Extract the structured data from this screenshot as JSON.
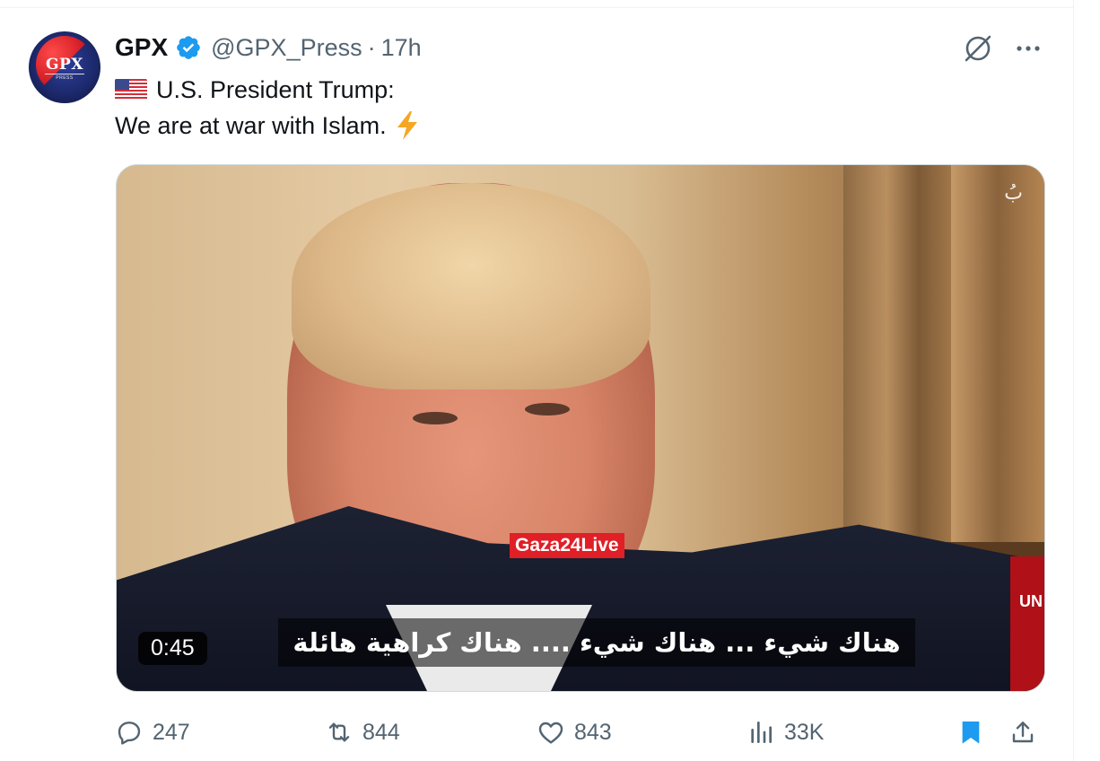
{
  "tweet": {
    "display_name": "GPX",
    "handle": "@GPX_Press",
    "separator": "·",
    "time": "17h",
    "avatar_text": "GPX",
    "avatar_subtext": "PRESS",
    "line1": "U.S. President Trump:",
    "line2": "We are at war with Islam."
  },
  "media": {
    "duration": "0:45",
    "channel_tag": "Gaza24Live",
    "subtitle": "هناك شيء ... هناك شيء .... هناك كراهية هائلة",
    "ticker_text": "UN",
    "watermark": "بُ"
  },
  "actions": {
    "replies": "247",
    "reposts": "844",
    "likes": "843",
    "views": "33K"
  },
  "colors": {
    "verified": "#1d9bf0",
    "bookmark": "#1d9bf0",
    "secondary_text": "#536471",
    "primary_text": "#0f1419"
  },
  "icons": [
    "verified-badge-icon",
    "grok-icon",
    "more-icon",
    "flag-us-icon",
    "lightning-icon",
    "reply-icon",
    "repost-icon",
    "like-icon",
    "views-icon",
    "bookmark-icon",
    "share-icon"
  ]
}
